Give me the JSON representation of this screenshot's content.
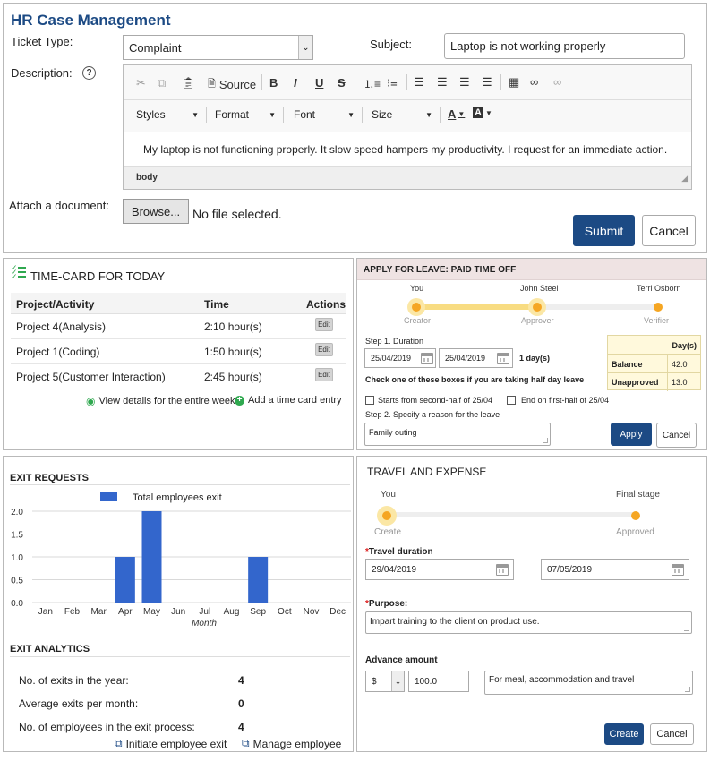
{
  "hr": {
    "title": "HR Case Management",
    "ticket_label": "Ticket Type:",
    "ticket_value": "Complaint",
    "subject_label": "Subject:",
    "subject_value": "Laptop is not working properly",
    "desc_label": "Description:",
    "help": "?",
    "source": "Source",
    "styles": "Styles",
    "format": "Format",
    "font": "Font",
    "size": "Size",
    "editor_text": "My laptop is not functioning properly. It slow speed hampers my productivity. I request for an immediate action.",
    "status": "body",
    "attach_label": "Attach a document:",
    "browse": "Browse...",
    "no_file": "No file selected.",
    "submit": "Submit",
    "cancel": "Cancel"
  },
  "timecard": {
    "title": "TIME-CARD FOR TODAY",
    "headers": [
      "Project/Activity",
      "Time",
      "Actions"
    ],
    "rows": [
      {
        "project": "Project 4(Analysis)",
        "time": "2:10 hour(s)",
        "action": "Edit"
      },
      {
        "project": "Project 1(Coding)",
        "time": "1:50 hour(s)",
        "action": "Edit"
      },
      {
        "project": "Project 5(Customer Interaction)",
        "time": "2:45 hour(s)",
        "action": "Edit"
      }
    ],
    "view_link": "View details for the entire week",
    "add_link": "Add a time card entry"
  },
  "leave": {
    "title": "APPLY FOR LEAVE: PAID TIME OFF",
    "steps": [
      {
        "who": "You",
        "role": "Creator"
      },
      {
        "who": "John Steel",
        "role": "Approver"
      },
      {
        "who": "Terri Osborn",
        "role": "Verifier"
      }
    ],
    "step1": "Step 1. Duration",
    "from": "25/04/2019",
    "to": "25/04/2019",
    "days": "1 day(s)",
    "half_note": "Check one of these boxes if you are taking half day leave",
    "opt1": "Starts from second-half of 25/04",
    "opt2": "End on first-half of 25/04",
    "step2": "Step 2. Specify a reason for the leave",
    "reason": "Family outing",
    "apply": "Apply",
    "cancel": "Cancel",
    "bal_header": "Day(s)",
    "balance_label": "Balance",
    "balance_value": "42.0",
    "unapproved_label": "Unapproved",
    "unapproved_value": "13.0"
  },
  "exit": {
    "title": "EXIT REQUESTS",
    "analytics_title": "EXIT ANALYTICS",
    "stats": [
      {
        "label": "No. of exits in the year:",
        "value": "4"
      },
      {
        "label": "Average exits per month:",
        "value": "0"
      },
      {
        "label": "No. of employees in the exit process:",
        "value": "4"
      }
    ],
    "initiate": "Initiate employee exit",
    "manage": "Manage employee"
  },
  "chart_data": {
    "type": "bar",
    "categories": [
      "Jan",
      "Feb",
      "Mar",
      "Apr",
      "May",
      "Jun",
      "Jul",
      "Aug",
      "Sep",
      "Oct",
      "Nov",
      "Dec"
    ],
    "series": [
      {
        "name": "Total employees exit",
        "values": [
          0,
          0,
          0,
          1,
          2,
          0,
          0,
          0,
          1,
          0,
          0,
          0
        ]
      }
    ],
    "xlabel": "Month",
    "ylabel": "",
    "yticks": [
      "0.0",
      "0.5",
      "1.0",
      "1.5",
      "2.0"
    ],
    "ylim": [
      0,
      2
    ],
    "legend": "top-center",
    "color": "#3366cc"
  },
  "travel": {
    "title": "TRAVEL AND EXPENSE",
    "steps": [
      {
        "who": "You",
        "role": "Create"
      },
      {
        "who": "Final stage",
        "role": "Approved"
      }
    ],
    "duration_label": "Travel duration",
    "from": "29/04/2019",
    "to": "07/05/2019",
    "purpose_label": "Purpose:",
    "purpose": "Impart training to the client on product use.",
    "advance_label": "Advance amount",
    "currency": "$",
    "amount": "100.0",
    "note": "For meal, accommodation and travel",
    "create": "Create",
    "cancel": "Cancel",
    "req": "*"
  },
  "colors": {
    "brand": "#1c4a84",
    "accent": "#f5a623",
    "bar": "#3366cc",
    "green": "#2fa84f"
  }
}
